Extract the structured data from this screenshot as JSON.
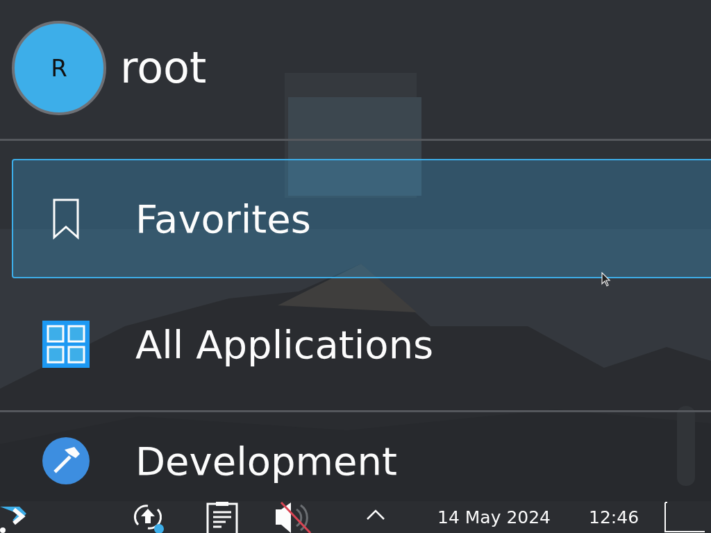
{
  "user": {
    "initial": "R",
    "name": "root"
  },
  "categories": [
    {
      "label": "Favorites",
      "kind": "bookmark",
      "selected": true
    },
    {
      "label": "All Applications",
      "kind": "grid",
      "selected": false
    }
  ],
  "more_categories": [
    {
      "label": "Development",
      "kind": "hammer",
      "selected": false
    }
  ],
  "taskbar": {
    "volume_muted": true,
    "update_pending": true,
    "date": "14 May 2024",
    "time": "12:46"
  }
}
